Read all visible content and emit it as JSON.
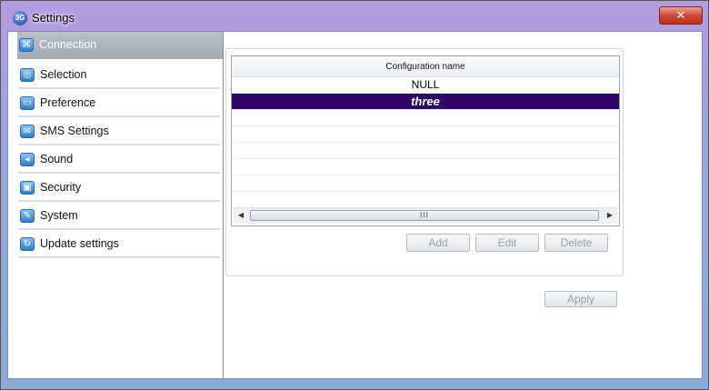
{
  "window": {
    "title": "Settings",
    "app_icon": "3G",
    "close_glyph": "✕"
  },
  "sidebar": {
    "items": [
      {
        "label": "Connection",
        "icon": "network-icon",
        "selected": true
      },
      {
        "label": "Selection",
        "icon": "selection-icon",
        "selected": false
      },
      {
        "label": "Preference",
        "icon": "monitor-icon",
        "selected": false
      },
      {
        "label": "SMS Settings",
        "icon": "envelope-icon",
        "selected": false
      },
      {
        "label": "Sound",
        "icon": "speaker-icon",
        "selected": false
      },
      {
        "label": "Security",
        "icon": "lock-icon",
        "selected": false
      },
      {
        "label": "System",
        "icon": "tools-icon",
        "selected": false
      },
      {
        "label": "Update settings",
        "icon": "update-icon",
        "selected": false
      }
    ]
  },
  "config_table": {
    "header": "Configuration name",
    "rows": [
      {
        "name": "NULL",
        "selected": false
      },
      {
        "name": "three",
        "selected": true
      }
    ],
    "scrollbar_grip": "III"
  },
  "buttons": {
    "add": "Add",
    "edit": "Edit",
    "delete": "Delete",
    "apply": "Apply"
  },
  "colors": {
    "selected_row": "#2e0764",
    "selected_nav": "#a9b0b9"
  }
}
